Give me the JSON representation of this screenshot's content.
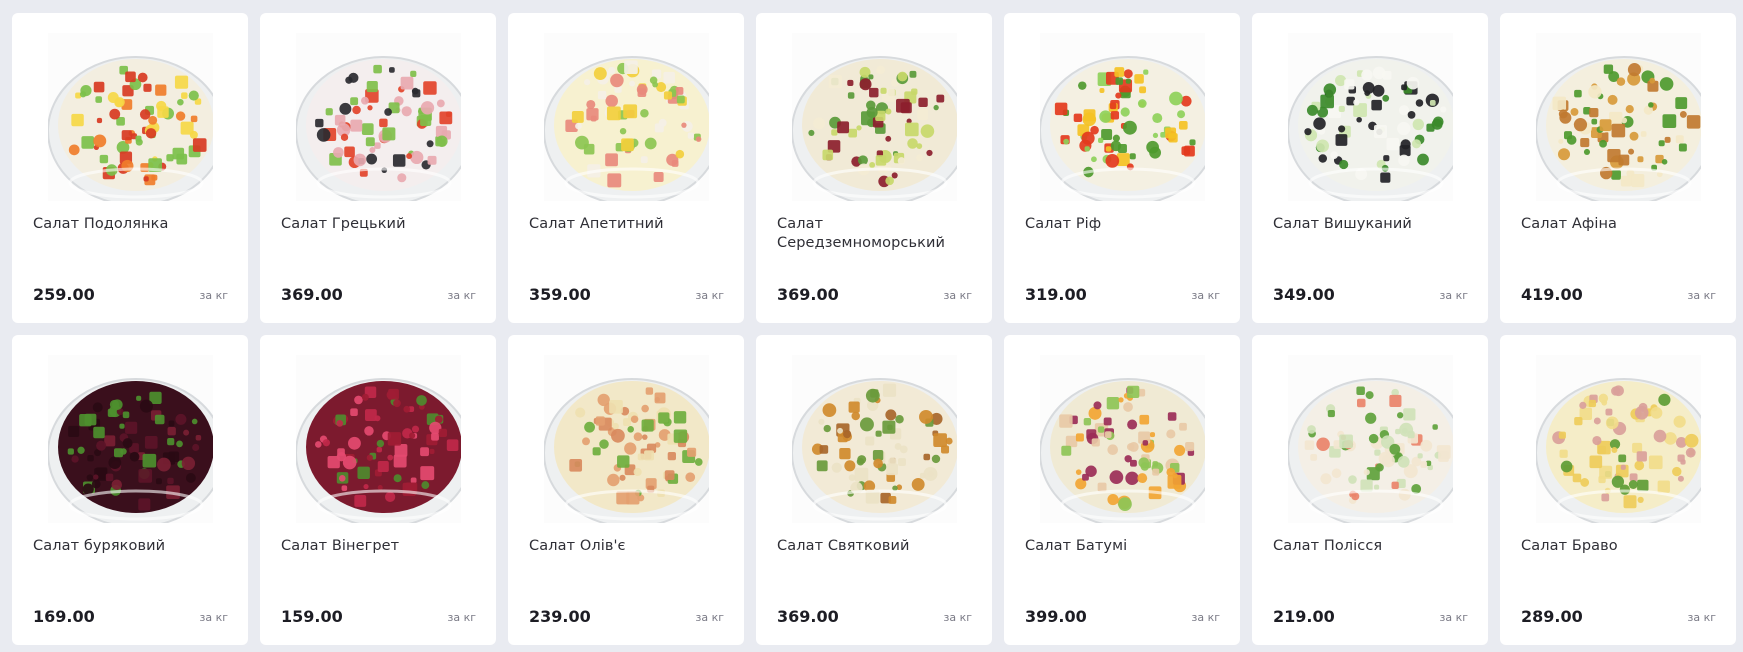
{
  "unit_label": "за кг",
  "products": [
    {
      "name": "Салат Подолянка",
      "price": "259.00",
      "image": "salad-podolyanka-image",
      "colors": [
        "#f3eee0",
        "#7cc04a",
        "#f07d2a",
        "#d83a22",
        "#f6d846"
      ]
    },
    {
      "name": "Салат Грецький",
      "price": "369.00",
      "image": "salad-greek-image",
      "colors": [
        "#f4eeee",
        "#e2432a",
        "#2a2a30",
        "#7fbf4a",
        "#e8a9b0"
      ]
    },
    {
      "name": "Салат Апетитний",
      "price": "359.00",
      "image": "salad-apetytnyi-image",
      "colors": [
        "#f7f1d0",
        "#f2cf3c",
        "#8cc651",
        "#e88a7c",
        "#f4f0e6"
      ]
    },
    {
      "name": "Салат Середземноморський",
      "price": "369.00",
      "image": "salad-mediterranean-image",
      "colors": [
        "#f1ead6",
        "#8c1e2c",
        "#c8d86a",
        "#f4ecd4",
        "#5a9a3a"
      ]
    },
    {
      "name": "Салат Ріф",
      "price": "319.00",
      "image": "salad-rif-image",
      "colors": [
        "#f4f0e2",
        "#f4c224",
        "#8ed15a",
        "#e33a1d",
        "#4e9a2e"
      ]
    },
    {
      "name": "Салат Вишуканий",
      "price": "349.00",
      "image": "salad-vyshukanyi-image",
      "colors": [
        "#f1f2ec",
        "#3b8a2a",
        "#222226",
        "#cfe6b0",
        "#f7f7f2"
      ]
    },
    {
      "name": "Салат Афіна",
      "price": "419.00",
      "image": "salad-afina-image",
      "colors": [
        "#f4efde",
        "#d79a3a",
        "#4d9a2e",
        "#f3e8c6",
        "#c07a30"
      ]
    },
    {
      "name": "Салат буряковий",
      "price": "169.00",
      "image": "salad-beet-image",
      "colors": [
        "#3a0f1c",
        "#5c1428",
        "#7a1f33",
        "#2a0a14",
        "#4d8f2e"
      ]
    },
    {
      "name": "Салат Вінегрет",
      "price": "159.00",
      "image": "salad-vinegret-image",
      "colors": [
        "#7c1a2e",
        "#c0284a",
        "#e44a70",
        "#a01c34",
        "#4e8a2e"
      ]
    },
    {
      "name": "Салат Олів'є",
      "price": "239.00",
      "image": "salad-olivier-image",
      "colors": [
        "#f2e8c8",
        "#e4a070",
        "#6fae3e",
        "#efdfb0",
        "#d98a5e"
      ]
    },
    {
      "name": "Салат Святковий",
      "price": "369.00",
      "image": "salad-svyatkovyi-image",
      "colors": [
        "#f2ead6",
        "#d08a2c",
        "#a8662a",
        "#ece2c6",
        "#6a9a3c"
      ]
    },
    {
      "name": "Салат Батумі",
      "price": "399.00",
      "image": "salad-batumi-image",
      "colors": [
        "#f0ead4",
        "#e8c9a6",
        "#8ec456",
        "#f2a533",
        "#9b2c57"
      ]
    },
    {
      "name": "Салат Полісся",
      "price": "219.00",
      "image": "salad-polissya-image",
      "colors": [
        "#f4efe6",
        "#e9836a",
        "#5ea23c",
        "#f2e6d0",
        "#cfe2b8"
      ]
    },
    {
      "name": "Салат Браво",
      "price": "289.00",
      "image": "salad-bravo-image",
      "colors": [
        "#f5edc8",
        "#f1dc8a",
        "#d9a09a",
        "#5d9c35",
        "#eecc5a"
      ]
    }
  ]
}
